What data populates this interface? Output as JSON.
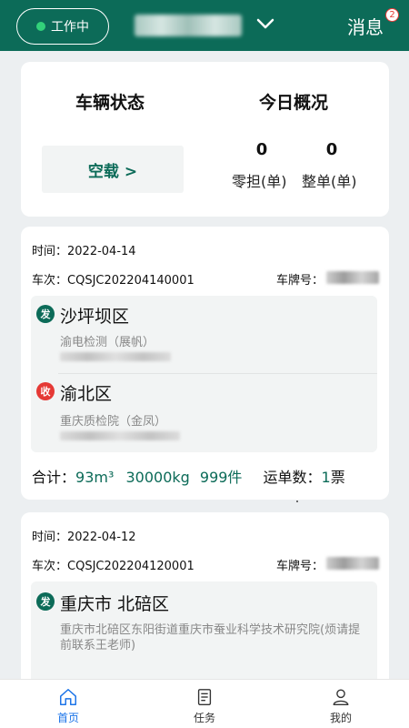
{
  "header": {
    "status_label": "工作中",
    "messages_label": "消息",
    "badge_count": "2"
  },
  "overview": {
    "vehicle_status_title": "车辆状态",
    "today_title": "今日概况",
    "vehicle_status_value": "空载 >",
    "less_than_load_count": "0",
    "less_than_load_label": "零担(单)",
    "full_load_count": "0",
    "full_load_label": "整单(单)"
  },
  "orders": [
    {
      "time_label": "时间：",
      "time": "2022-04-14",
      "trip_label": "车次：",
      "trip_no": "CQSJC202204140001",
      "plate_label": "车牌号：",
      "from_tag": "发",
      "from_place": "沙坪坝区",
      "from_detail": "渝电检测（展帆）",
      "to_tag": "收",
      "to_place": "渝北区",
      "to_detail": "重庆质检院（金凤）",
      "total_label": "合计：",
      "volume": "93m³",
      "weight": "30000kg",
      "pieces": "999件",
      "waybill_label": "运单数：",
      "waybill_count": "1",
      "waybill_unit": "票"
    },
    {
      "time_label": "时间：",
      "time": "2022-04-12",
      "trip_label": "车次：",
      "trip_no": "CQSJC202204120001",
      "plate_label": "车牌号：",
      "from_tag": "发",
      "from_place": "重庆市 北碚区",
      "from_detail": "重庆市北碚区东阳街道重庆市蚕业科学技术研究院(烦请提前联系王老师)"
    }
  ],
  "tabs": [
    {
      "label": "首页",
      "icon": "home-icon",
      "active": true
    },
    {
      "label": "任务",
      "icon": "task-document-icon",
      "active": false
    },
    {
      "label": "我的",
      "icon": "user-icon",
      "active": false
    }
  ],
  "colors": {
    "brand": "#0c6b58",
    "receive": "#e53935",
    "active_tab": "#1a73e8"
  }
}
